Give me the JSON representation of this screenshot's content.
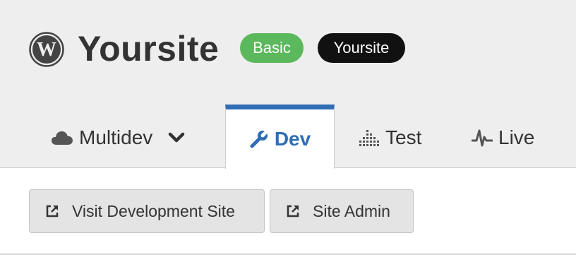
{
  "site": {
    "name": "Yoursite",
    "logo_icon": "wordpress-icon",
    "plan_badge": "Basic",
    "org_badge": "Yoursite"
  },
  "colors": {
    "header_bg": "#eeeeee",
    "plan_badge": "#5cb85c",
    "org_badge": "#111111",
    "active_tab": "#2f6db5",
    "button_bg": "#e4e4e4"
  },
  "tabs": [
    {
      "label": "Multidev",
      "icon": "cloud-icon",
      "dropdown": true,
      "active": false
    },
    {
      "label": "Dev",
      "icon": "wrench-icon",
      "active": true
    },
    {
      "label": "Test",
      "icon": "bars-icon",
      "active": false
    },
    {
      "label": "Live",
      "icon": "pulse-icon",
      "active": false
    }
  ],
  "actions": [
    {
      "label": "Visit Development Site",
      "icon": "external-link-icon"
    },
    {
      "label": "Site Admin",
      "icon": "external-link-icon"
    }
  ]
}
